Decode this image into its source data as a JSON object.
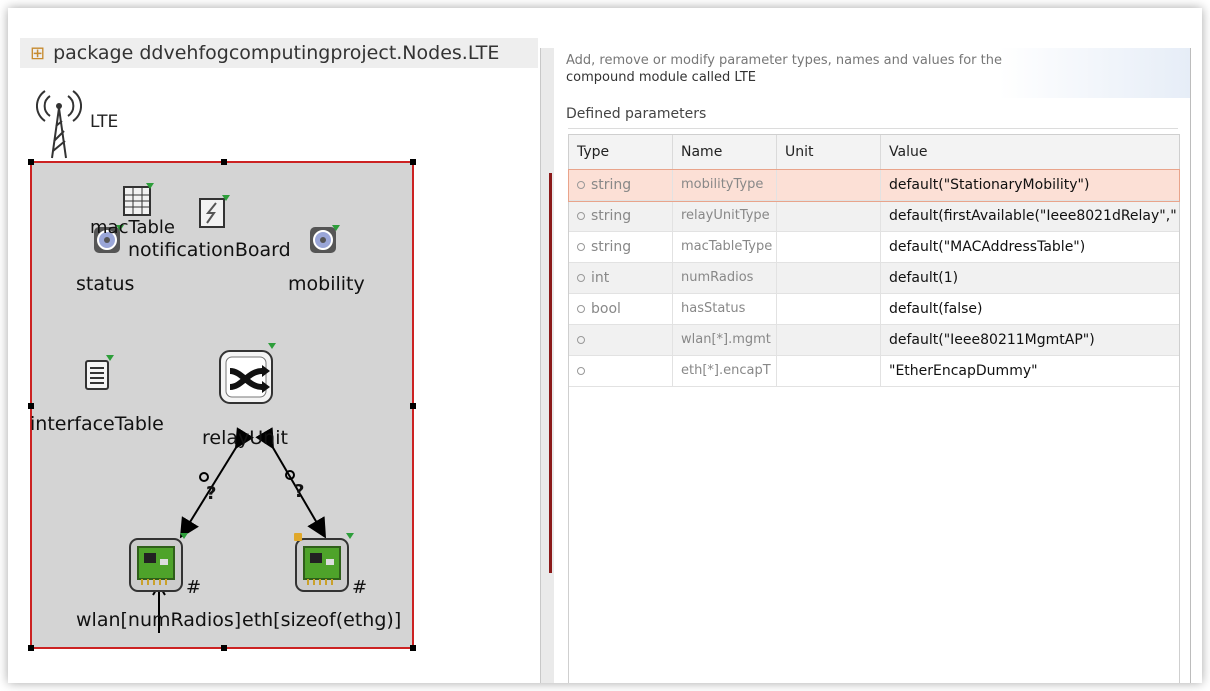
{
  "editor": {
    "package_label": "package ddvehfogcomputingproject.Nodes.LTE",
    "module_name": "LTE",
    "submodules": {
      "macTable": "macTable",
      "notificationBoard": "notificationBoard",
      "status": "status",
      "mobility": "mobility",
      "interfaceTable": "interfaceTable",
      "relayUnit": "relayUnit",
      "wlan": "wlan[numRadios]",
      "eth": "eth[sizeof(ethg)]"
    },
    "connection_marker": "?",
    "vector_marker": "#"
  },
  "dialog": {
    "description_line1": "Add, remove or modify parameter types, names and values for the",
    "description_line2": "compound module called LTE",
    "group_label": "Defined parameters",
    "columns": [
      "Type",
      "Name",
      "Unit",
      "Value"
    ],
    "rows": [
      {
        "type": "string",
        "name": "mobilityType",
        "unit": "",
        "value": "default(\"StationaryMobility\")"
      },
      {
        "type": "string",
        "name": "relayUnitType",
        "unit": "",
        "value": "default(firstAvailable(\"Ieee8021dRelay\",\""
      },
      {
        "type": "string",
        "name": "macTableType",
        "unit": "",
        "value": "default(\"MACAddressTable\")"
      },
      {
        "type": "int",
        "name": "numRadios",
        "unit": "",
        "value": "default(1)"
      },
      {
        "type": "bool",
        "name": "hasStatus",
        "unit": "",
        "value": "default(false)"
      },
      {
        "type": "",
        "name": "wlan[*].mgmt",
        "unit": "",
        "value": "default(\"Ieee80211MgmtAP\")"
      },
      {
        "type": "",
        "name": "eth[*].encapT",
        "unit": "",
        "value": "\"EtherEncapDummy\""
      }
    ]
  }
}
